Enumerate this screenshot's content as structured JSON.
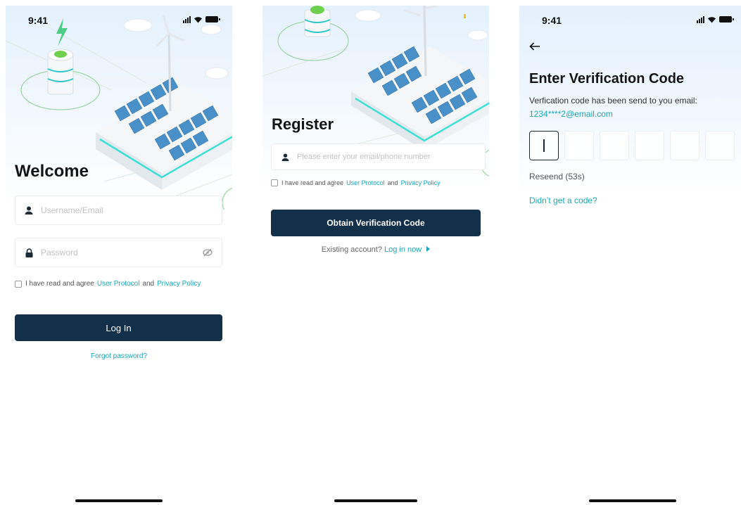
{
  "status": {
    "time": "9:41"
  },
  "login": {
    "title": "Welcome",
    "username_placeholder": "Username/Email",
    "password_placeholder": "Password",
    "agree_prefix": "I have read and agree",
    "user_protocol": "User Protocol",
    "and": "and",
    "privacy_policy": "Privacy Policy",
    "login_button": "Log In",
    "forgot_password": "Forgot password?"
  },
  "register": {
    "title": "Register",
    "contact_placeholder": "Please enter your email/phone number",
    "agree_prefix": "I have read and agree",
    "user_protocol": "User Protocol",
    "and": "and",
    "privacy_policy": "Privacy Policy",
    "obtain_button": "Obtain Verification Code",
    "existing_account": "Existing account?",
    "login_now": "Log in now"
  },
  "verify": {
    "title": "Enter Verification Code",
    "sent_text": "Verfication code has been send to you email:",
    "email": "1234****2@email.com",
    "resend": "Reseend (53s)",
    "no_code": "Didn’t get a code?"
  },
  "colors": {
    "brand_navy": "#12304a",
    "accent_teal": "#1aa7b8",
    "solar_blue": "#4a90c8"
  },
  "icons": [
    "signal-icon",
    "wifi-icon",
    "battery-icon",
    "user-icon",
    "lock-icon",
    "eye-off-icon",
    "back-arrow-icon",
    "chevron-right-icon"
  ]
}
